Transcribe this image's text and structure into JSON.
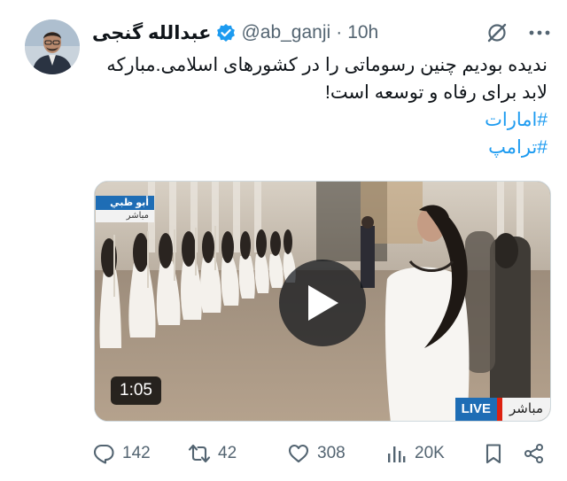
{
  "author": {
    "name": "عبدالله گنجی",
    "handle": "@ab_ganji",
    "separator": "·",
    "time": "10h",
    "verified": true
  },
  "tweet": {
    "line1": "ندیده بودیم چنین رسوماتی را در کشورهای اسلامی.مبارکه",
    "line2": "لابد برای رفاه و توسعه است!",
    "hashtags": [
      "#امارات",
      "#ترامپ"
    ]
  },
  "media": {
    "duration": "1:05",
    "channel_tag_top": "أبو ظبي",
    "channel_tag_bottom": "مباشر",
    "live_label": "LIVE",
    "live_arabic": "مباشر"
  },
  "actions": {
    "replies": "142",
    "reposts": "42",
    "likes": "308",
    "views": "20K"
  },
  "colors": {
    "accent": "#1d9bf0",
    "muted": "#536471",
    "text": "#0f1419",
    "verified": "#1d9bf0"
  },
  "icons": [
    "grok-icon",
    "more-icon",
    "reply-icon",
    "repost-icon",
    "like-icon",
    "views-icon",
    "bookmark-icon",
    "share-icon",
    "play-icon",
    "verified-icon"
  ]
}
